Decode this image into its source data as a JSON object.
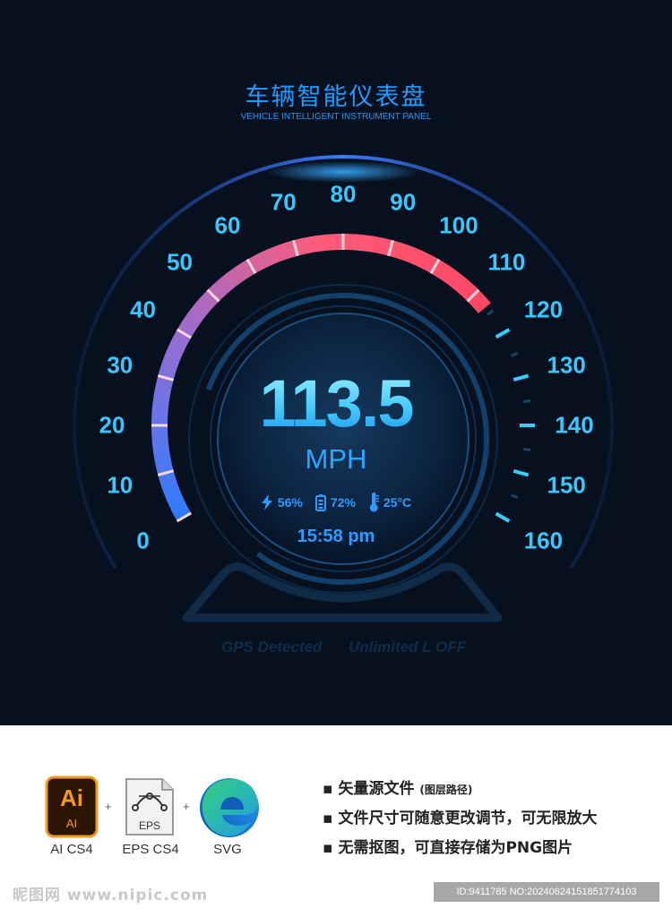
{
  "header": {
    "title_cn": "车辆智能仪表盘",
    "title_en": "VEHICLE INTELLIGENT INSTRUMENT PANEL"
  },
  "gauge": {
    "scale_labels": [
      "0",
      "10",
      "20",
      "30",
      "40",
      "50",
      "60",
      "70",
      "80",
      "90",
      "100",
      "110",
      "120",
      "130",
      "140",
      "150",
      "160"
    ],
    "min": 0,
    "max": 160,
    "current_speed": 113.5,
    "speed_text": "113.5",
    "unit": "MPH"
  },
  "status": {
    "power": "56%",
    "battery": "72%",
    "temperature": "25°C",
    "time": "15:58 pm"
  },
  "indicators": {
    "gps": "GPS Detected",
    "limit": "Unlimited L OFF"
  },
  "colors": {
    "background": "#07101e",
    "accent": "#37c8ff",
    "arc_start": "#2f7bff",
    "arc_mid": "#ff5b78",
    "title": "#1e9bff"
  },
  "formats": {
    "ai_icon": "Ai",
    "ai_sub": "AI",
    "ai_label": "AI CS4",
    "eps_icon": "EPS",
    "eps_label": "EPS CS4",
    "svg_label": "SVG",
    "plus": "+"
  },
  "features": {
    "line1": "矢量源文件",
    "line1_note": "(图层路径)",
    "line2": "文件尺寸可随意更改调节，可无限放大",
    "line3": "无需抠图，可直接存储为PNG图片"
  },
  "watermark": {
    "site": "昵图网 www.nipic.com",
    "id": "ID:9411785 NO:20240624151851774103"
  }
}
